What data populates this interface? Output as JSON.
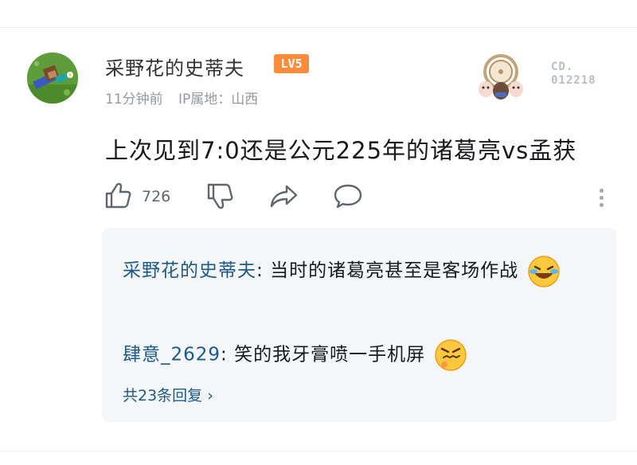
{
  "comment": {
    "username": "采野花的史蒂夫",
    "level_badge": "LV5",
    "time_ago": "11分钟前",
    "ip_location": "IP属地：山西",
    "decoration_code_line1": "CD.",
    "decoration_code_line2": "012218",
    "content": "上次见到7:0还是公元225年的诸葛亮vs孟获",
    "like_count": "726"
  },
  "replies": [
    {
      "name": "采野花的史蒂夫",
      "text": "当时的诸葛亮甚至是客场作战",
      "emoji": "laughing-tears-emoji"
    },
    {
      "name": "肆意_2629",
      "text": "笑的我牙膏喷一手机屏",
      "emoji": "grimacing-emoji"
    }
  ],
  "reply_summary": "共23条回复",
  "colors": {
    "level_badge": "#ff8c3a",
    "reply_name": "#1c5a8a",
    "reply_box_bg": "#f5f6f8",
    "meta_text": "#9499a0"
  },
  "icons": [
    "thumbs-up-icon",
    "thumbs-down-icon",
    "share-icon",
    "comment-icon",
    "more-vertical-icon",
    "chevron-right-icon"
  ]
}
